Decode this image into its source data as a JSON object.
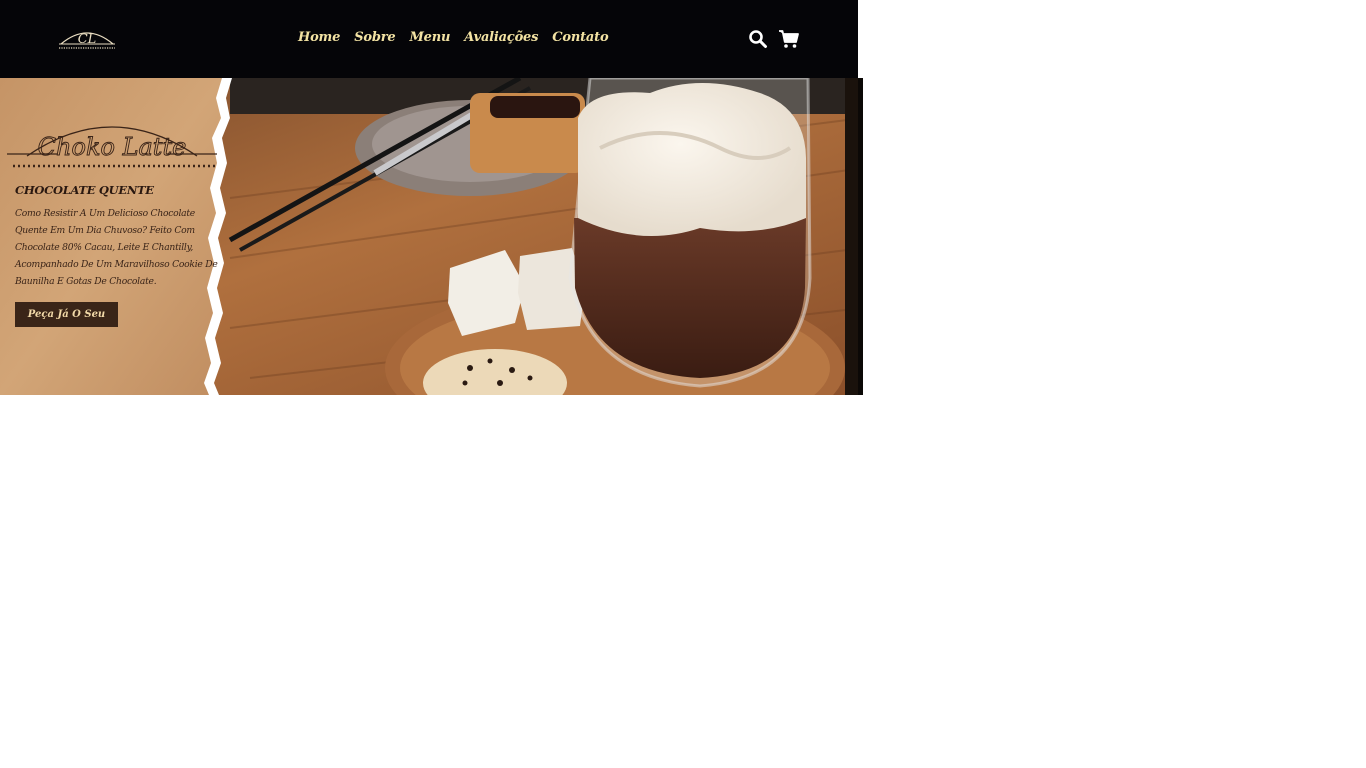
{
  "header": {
    "logo_text": "CL",
    "nav": [
      {
        "label": "Home"
      },
      {
        "label": "Sobre"
      },
      {
        "label": "Menu"
      },
      {
        "label": "Avaliações"
      },
      {
        "label": "Contato"
      }
    ],
    "icons": {
      "search": "search-icon",
      "cart": "cart-icon"
    }
  },
  "hero": {
    "brand": "Choko Latte",
    "title": "CHOCOLATE QUENTE",
    "description": "Como Resistir A Um Delicioso Chocolate Quente Em Um Dia Chuvoso? Feito Com Chocolate 80% Cacau, Leite E Chantilly, Acompanhado De Um Maravilhoso Cookie De Baunilha E Gotas De Chocolate.",
    "cta_label": "Peça Já O Seu"
  },
  "colors": {
    "header_bg": "#050508",
    "nav_text": "#f3e3a3",
    "paper": "#c99a6c",
    "cta_bg": "#3a2518",
    "cta_text": "#f1d9a8"
  }
}
